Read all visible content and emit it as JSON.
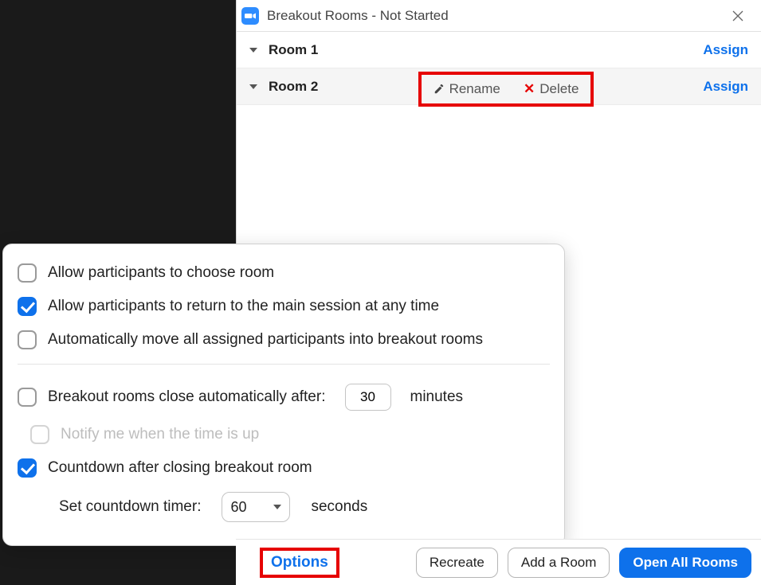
{
  "window": {
    "title": "Breakout Rooms - Not Started"
  },
  "rooms": [
    {
      "name": "Room 1",
      "assign_label": "Assign"
    },
    {
      "name": "Room 2",
      "assign_label": "Assign"
    }
  ],
  "context_menu": {
    "rename": "Rename",
    "delete": "Delete"
  },
  "options_popover": {
    "choose_room": {
      "label": "Allow participants to choose room",
      "checked": false
    },
    "return_main": {
      "label": "Allow participants to return to the main session at any time",
      "checked": true
    },
    "auto_move": {
      "label": "Automatically move all assigned participants into breakout rooms",
      "checked": false
    },
    "close_after": {
      "label_before": "Breakout rooms close automatically after:",
      "value": "30",
      "label_after": "minutes",
      "checked": false
    },
    "notify_time": {
      "label": "Notify me when the time is up",
      "enabled": false
    },
    "countdown": {
      "label": "Countdown after closing breakout room",
      "checked": true
    },
    "timer": {
      "label_before": "Set countdown timer:",
      "value": "60",
      "label_after": "seconds"
    }
  },
  "footer": {
    "options": "Options",
    "recreate": "Recreate",
    "add_room": "Add a Room",
    "open_all": "Open All Rooms"
  }
}
